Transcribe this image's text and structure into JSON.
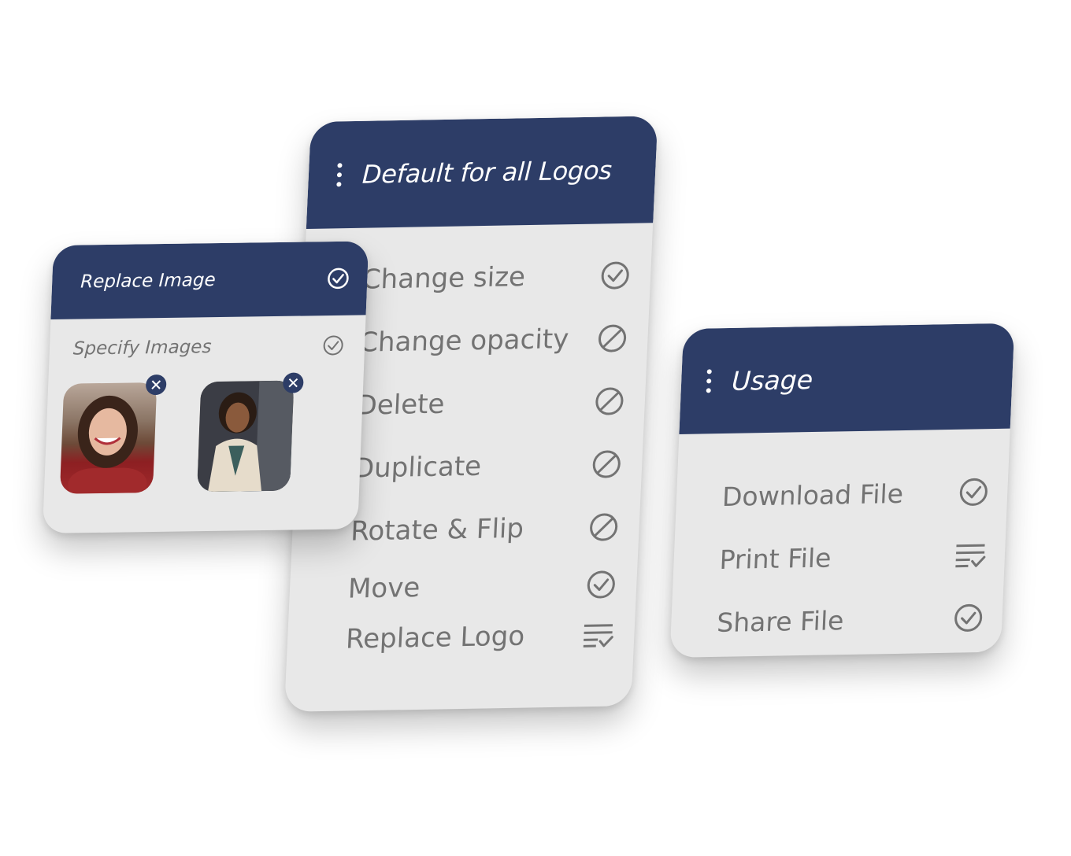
{
  "replace_panel": {
    "title": "Replace Image",
    "subtitle": "Specify Images"
  },
  "logos_panel": {
    "title": "Default for all Logos",
    "items": [
      {
        "label": "Change size",
        "icon": "check-circle-icon"
      },
      {
        "label": "Change opacity",
        "icon": "blocked-icon"
      },
      {
        "label": "Delete",
        "icon": "blocked-icon"
      },
      {
        "label": "Duplicate",
        "icon": "blocked-icon"
      },
      {
        "label": "Rotate & Flip",
        "icon": "blocked-icon"
      },
      {
        "label": "Move",
        "icon": "check-circle-icon"
      },
      {
        "label": "Replace Logo",
        "icon": "list-check-icon"
      }
    ]
  },
  "usage_panel": {
    "title": "Usage",
    "items": [
      {
        "label": "Download File",
        "icon": "check-circle-icon"
      },
      {
        "label": "Print File",
        "icon": "list-check-icon"
      },
      {
        "label": "Share File",
        "icon": "check-circle-icon"
      }
    ]
  },
  "colors": {
    "header": "#2d3d67",
    "panel": "#e8e8e8",
    "text": "#737373"
  }
}
